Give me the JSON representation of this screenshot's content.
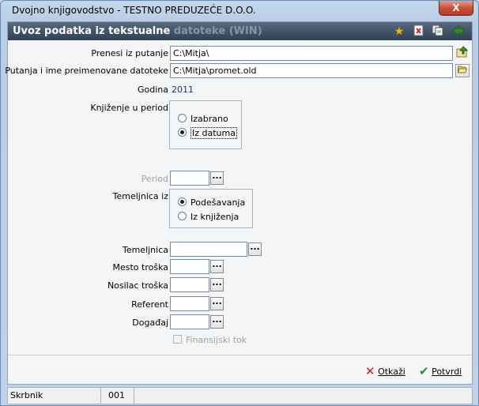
{
  "window": {
    "title": "Dvojno knjigovodstvo - TESTNO PREDUZEĆE D.O.O.",
    "close_label": "X"
  },
  "header": {
    "title_main": "Uvoz podatka iz tekstualne",
    "title_faded": "datoteke (WIN)",
    "icons": [
      "star-icon",
      "close-document-icon",
      "copy-icon",
      "export-icon"
    ]
  },
  "form": {
    "source_path": {
      "label": "Prenesi iz putanje",
      "value": "C:\\Mitja\\"
    },
    "renamed_file": {
      "label": "Putanja i ime preimenovane datoteke",
      "value": "C:\\Mitja\\promet.old"
    },
    "year": {
      "label": "Godina",
      "value": "2011"
    },
    "posting_period": {
      "label": "Knjiženje u period",
      "options": [
        "Izabrano",
        "Iz datuma"
      ],
      "selected": "Iz datuma"
    },
    "period": {
      "label": "Period",
      "value": ""
    },
    "basis_from": {
      "label": "Temeljnica iz",
      "options": [
        "Podešavanja",
        "Iz knjiženja"
      ],
      "selected": "Podešavanja"
    },
    "basis": {
      "label": "Temeljnica",
      "value": ""
    },
    "cost_center": {
      "label": "Mesto troška",
      "value": ""
    },
    "cost_bearer": {
      "label": "Nosilac troška",
      "value": ""
    },
    "referent": {
      "label": "Referent",
      "value": ""
    },
    "event": {
      "label": "Događaj",
      "value": ""
    },
    "cash_flow": {
      "label": "Finansijski tok",
      "checked": false
    }
  },
  "actions": {
    "cancel_label": "Otkaži",
    "confirm_label": "Potvrdi"
  },
  "statusbar": {
    "user": "Skrbnik",
    "code": "001"
  },
  "colors": {
    "header_bg": "#3b4b60",
    "year_text": "#1a2a8c",
    "cancel_icon": "#c0241b",
    "confirm_icon": "#2f8f1f"
  }
}
